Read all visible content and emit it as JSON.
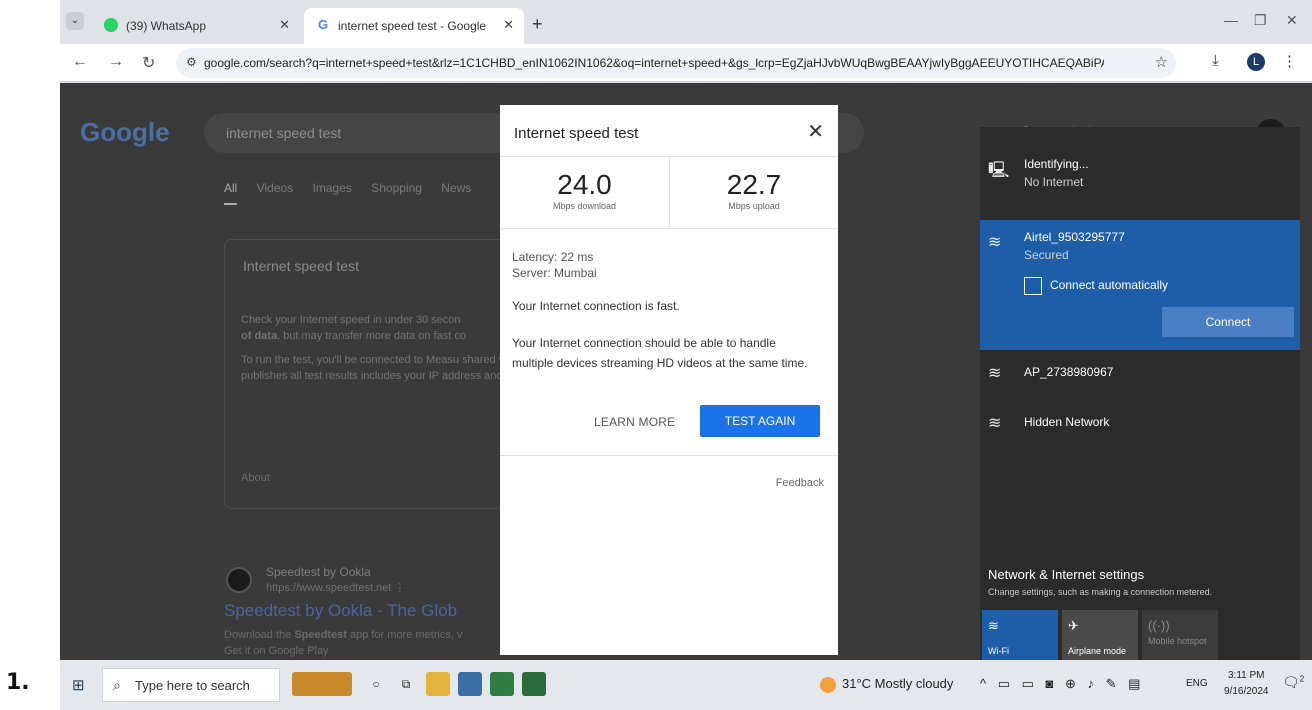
{
  "list_number": "1.",
  "browser": {
    "tabs": [
      {
        "label": "(39) WhatsApp",
        "favicon": "whatsapp-icon"
      },
      {
        "label": "internet speed test - Google Se",
        "favicon": "google-icon"
      }
    ],
    "new_tab": "+",
    "url": "google.com/search?q=internet+speed+test&rlz=1C1CHBD_enIN1062IN1062&oq=internet+speed+&gs_lcrp=EgZjaHJvbWUqBwgBEAAYjwIyBggAEEUYOTIHCAEQABiPA...",
    "profile_initial": "L"
  },
  "google": {
    "logo": "Google",
    "query": "internet speed test",
    "nav_tabs": [
      "All",
      "Videos",
      "Images",
      "Shopping",
      "News"
    ],
    "card": {
      "title": "Internet speed test",
      "para1_start": "Check your Internet speed in under 30 secon",
      "para1_bold": "of data",
      "para1_rest": ", but may transfer more data on fast co",
      "para2": "To run the test, you'll be connected to Measu shared with them and processed by them in a the test and publicly publishes all test results includes your IP address and test results, but Internet user.",
      "about": "About"
    },
    "ookla": {
      "site": "Speedtest by Ookla",
      "url": "https://www.speedtest.net ⋮",
      "link": "Speedtest by Ookla - The Glob",
      "desc_start": "Download the ",
      "desc_bold": "Speedtest",
      "desc_rest": " app for more metrics, v",
      "desc2": "Get it on Google Play"
    }
  },
  "speed_test": {
    "title": "Internet speed test",
    "download_value": "24.0",
    "download_label": "Mbps download",
    "upload_value": "22.7",
    "upload_label": "Mbps upload",
    "latency": "Latency: 22 ms",
    "server": "Server: Mumbai",
    "status": "Your Internet connection is fast.",
    "description": "Your Internet connection should be able to handle multiple devices streaming HD videos at the same time.",
    "learn_more": "LEARN MORE",
    "test_again": "TEST AGAIN",
    "feedback": "Feedback"
  },
  "network_flyout": {
    "current": {
      "name": "Identifying...",
      "status": "No Internet"
    },
    "selected": {
      "name": "Airtel_9503295777",
      "status": "Secured",
      "auto_connect_label": "Connect automatically",
      "connect_label": "Connect"
    },
    "others": [
      {
        "name": "AP_2738980967"
      },
      {
        "name": "Hidden Network"
      }
    ],
    "settings_title": "Network & Internet settings",
    "settings_sub": "Change settings, such as making a connection metered.",
    "tiles": [
      {
        "label": "Wi-Fi",
        "state": "on"
      },
      {
        "label": "Airplane mode",
        "state": "off"
      },
      {
        "label": "Mobile hotspot",
        "state": "disabled"
      }
    ],
    "accent": "#1e5ea8"
  },
  "taskbar": {
    "search_placeholder": "Type here to search",
    "weather": "31°C  Mostly cloudy",
    "language": "ENG",
    "time": "3:11 PM",
    "date": "9/16/2024",
    "notification_count": "2"
  }
}
